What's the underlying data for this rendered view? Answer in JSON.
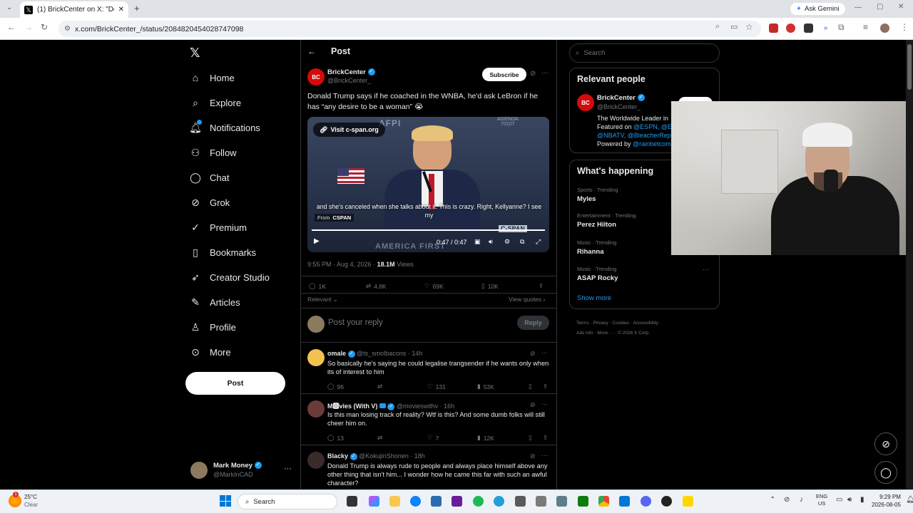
{
  "browser": {
    "tab_title": "(1) BrickCenter on X: \"Donald T",
    "url": "x.com/BrickCenter_/status/2084820454028747098",
    "ask_gemini": "Ask Gemini"
  },
  "nav": {
    "items": [
      "Home",
      "Explore",
      "Notifications",
      "Follow",
      "Chat",
      "Grok",
      "Premium",
      "Bookmarks",
      "Creator Studio",
      "Articles",
      "Profile",
      "More"
    ],
    "post_button": "Post",
    "account_name": "Mark Money",
    "account_handle": "@MarkInCAD"
  },
  "header": {
    "title": "Post"
  },
  "tweet": {
    "author": "BrickCenter",
    "handle": "@BrickCenter_",
    "subscribe": "Subscribe",
    "text": "Donald Trump says if he coached in the WNBA, he'd ask LeBron if he has “any desire to be a woman” 😭",
    "video_link": "Visit c-span.org",
    "caption": "and she's canceled when she talks about it. This is crazy. Right, Kellyanne? I see my",
    "from_label": "From",
    "from_source": "CSPAN",
    "time": "0:47 / 0:47",
    "meta_time": "9:55 PM · Aug 4, 2026 · ",
    "views_count": "18.1M",
    "views_label": " Views",
    "replies": "1K",
    "reposts": "4.8K",
    "likes": "69K",
    "bookmarks": "10K",
    "relevant": "Relevant",
    "view_quotes": "View quotes",
    "reply_placeholder": "Post your reply",
    "reply_button": "Reply",
    "video_bg_text_1": "AGENDA",
    "video_bg_text_2": "70107",
    "video_bg_text_3": "AMERICA FIRST",
    "video_watermark": "C-SPAN"
  },
  "replies": [
    {
      "name": "omale",
      "handle": "@ts_smolbacons · 14h",
      "text": "So basically he's saying he could legalise trangsender if he wants only when its of interest to him",
      "replies": "96",
      "likes": "131",
      "views": "53K"
    },
    {
      "name": "M🅾vies (With V)",
      "handle": "@movieswithv · 16h",
      "text": "Is this man losing track of reality? Wtf is this? And some dumb folks will still cheer him on.",
      "replies": "13",
      "likes": "7",
      "views": "12K"
    },
    {
      "name": "Blacky",
      "handle": "@KokujinShonen · 18h",
      "text": "Donald Trump is always rude to people and always place himself above any other thing that isn't him... I wonder how he came this far with such an awful character?",
      "replies": "",
      "likes": "",
      "views": ""
    }
  ],
  "sidebar": {
    "search_placeholder": "Search",
    "relevant_title": "Relevant people",
    "rp_name": "BrickCenter",
    "rp_handle": "@BrickCenter_",
    "rp_bio_1": "The Worldwide Leader in",
    "rp_bio_2a": "Featured on ",
    "rp_bio_2b": "@ESPN",
    "rp_bio_2c": ", @ES",
    "rp_bio_3": "@NBATV, @BleacherRepo",
    "rp_bio_4a": "Powered by ",
    "rp_bio_4b": "@rainbetcom",
    "happening_title": "What's happening",
    "trends": [
      {
        "context": "Sports · Trending",
        "name": "Myles"
      },
      {
        "context": "Entertainment · Trending",
        "name": "Perez Hilton"
      },
      {
        "context": "Music · Trending",
        "name": "Rihanna"
      },
      {
        "context": "Music · Trending",
        "name": "ASAP Rocky"
      }
    ],
    "show_more": "Show more",
    "footer_1": "Terms  ·  Privacy  ·  Cookies  ·  Accessibility  ·",
    "footer_2": "Ads info  ·  More ···  ·  © 2026 X Corp."
  },
  "taskbar": {
    "weather_temp": "25°C",
    "weather_desc": "Clear",
    "search": "Search",
    "lang_1": "ENG",
    "lang_2": "US",
    "clock_time": "9:29 PM",
    "clock_date": "2026-08-05"
  },
  "colors": {
    "accent": "#1d9bf0",
    "brand_red": "#d50a0a"
  }
}
